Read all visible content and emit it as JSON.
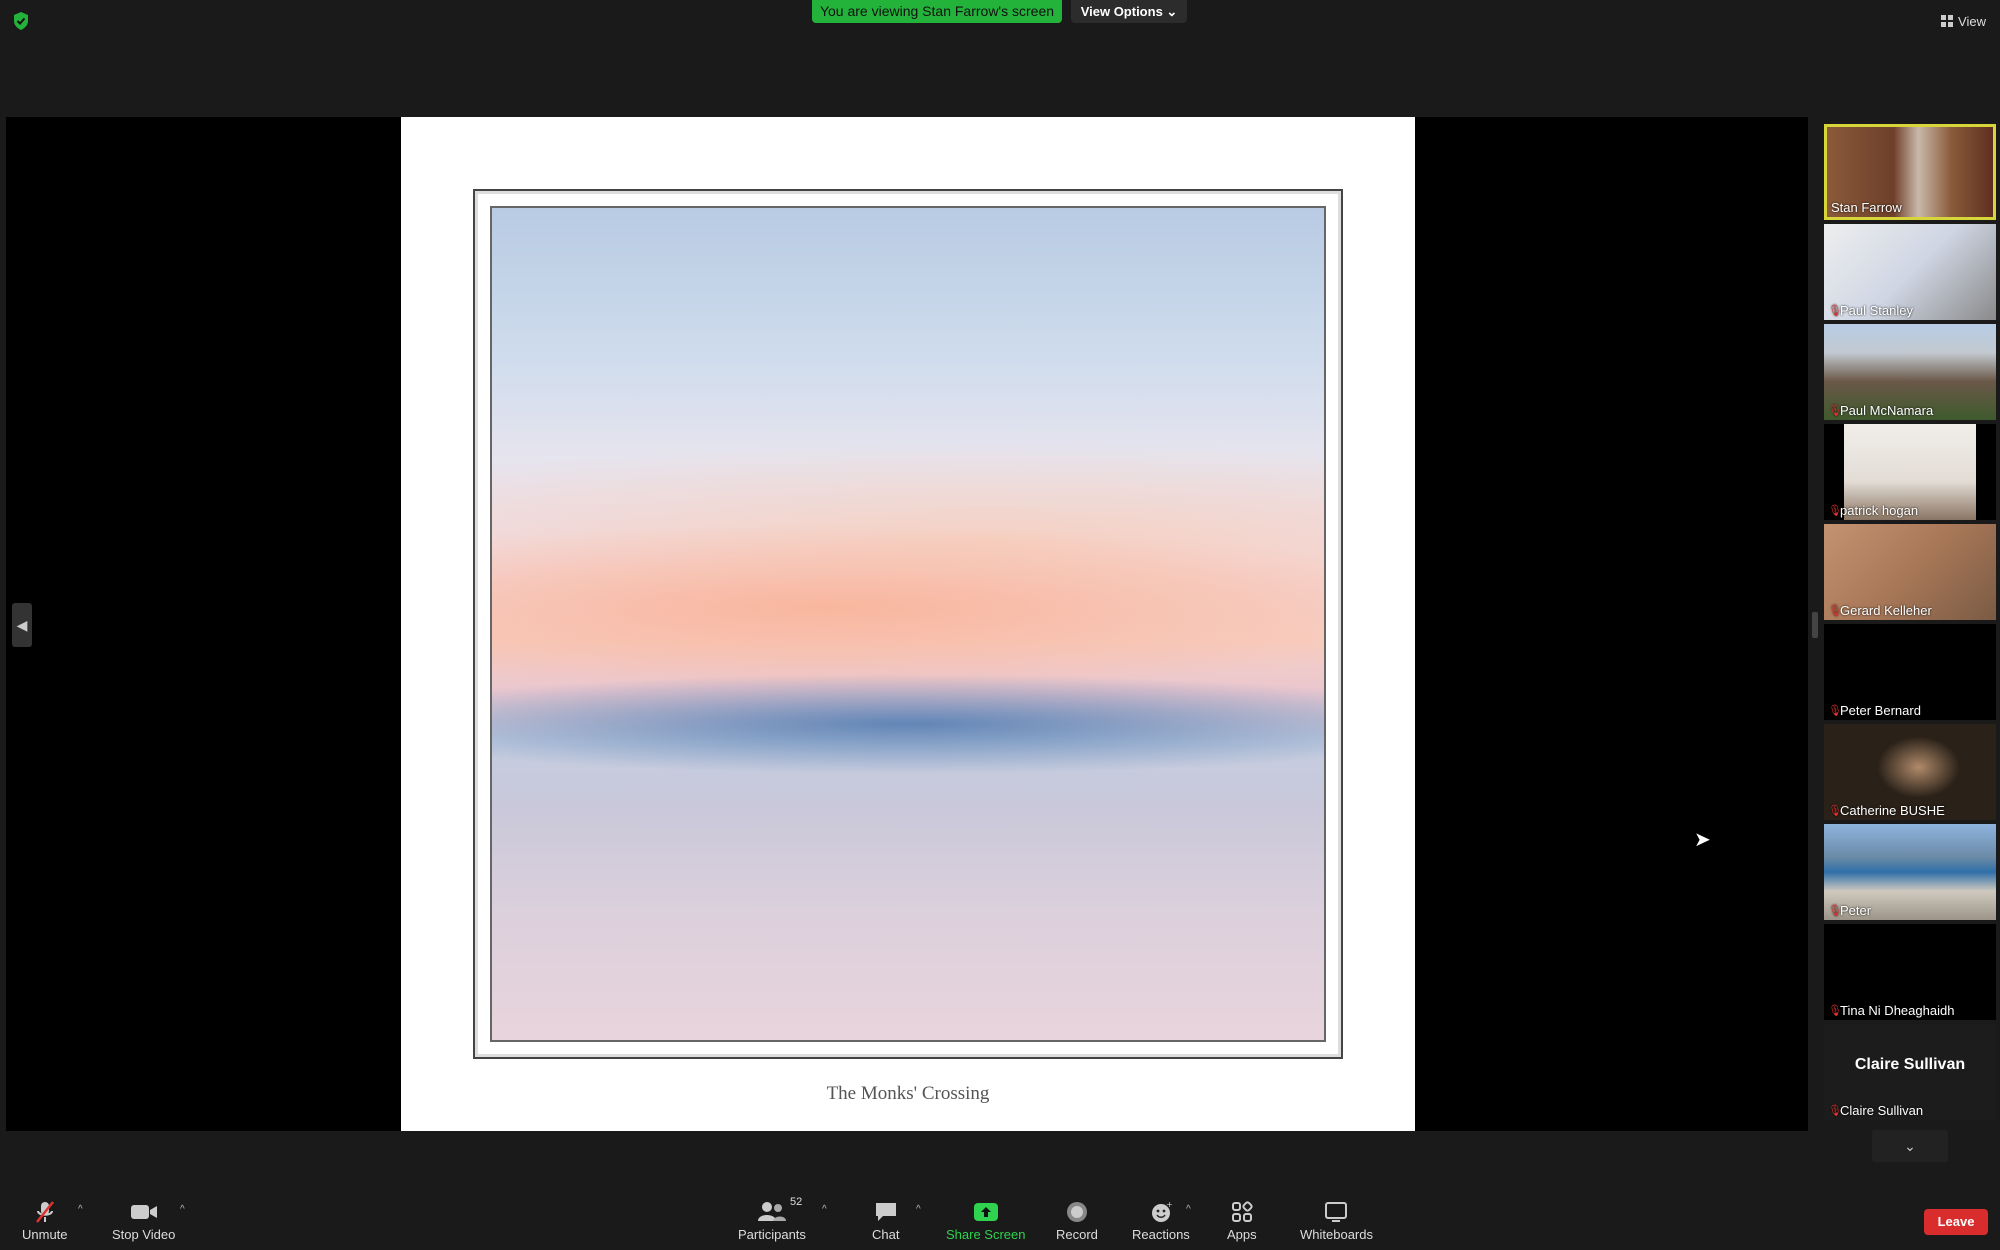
{
  "banner": {
    "viewing_text": "You are viewing Stan Farrow's screen",
    "view_options_label": "View Options ⌄"
  },
  "view_button": {
    "label": "View"
  },
  "slide": {
    "caption": "The Monks' Crossing"
  },
  "gallery": {
    "participants": [
      {
        "name": "Stan Farrow",
        "muted": false,
        "active_speaker": true
      },
      {
        "name": "Paul Stanley",
        "muted": true
      },
      {
        "name": "Paul McNamara",
        "muted": true
      },
      {
        "name": "patrick hogan",
        "muted": true
      },
      {
        "name": "Gerard Kelleher",
        "muted": true
      },
      {
        "name": "Peter Bernard",
        "muted": true
      },
      {
        "name": "Catherine BUSHE",
        "muted": true
      },
      {
        "name": "Peter",
        "muted": true
      },
      {
        "name": "Tina Ni Dheaghaidh",
        "muted": true
      },
      {
        "name": "Claire Sullivan",
        "muted": true,
        "no_video": true
      }
    ]
  },
  "toolbar": {
    "unmute": "Unmute",
    "stop_video": "Stop Video",
    "participants": "Participants",
    "participants_count": "52",
    "chat": "Chat",
    "share_screen": "Share Screen",
    "record": "Record",
    "reactions": "Reactions",
    "apps": "Apps",
    "whiteboards": "Whiteboards",
    "leave": "Leave"
  },
  "colors": {
    "banner_green": "#23b33b",
    "leave_red": "#d92d2d",
    "share_green": "#2fd34f",
    "active_border": "#d6d53a"
  },
  "icons": [
    "shield-icon",
    "grid-icon",
    "mic-off-icon",
    "video-icon",
    "participants-icon",
    "chat-icon",
    "share-screen-icon",
    "record-icon",
    "reactions-icon",
    "apps-icon",
    "whiteboard-icon"
  ]
}
